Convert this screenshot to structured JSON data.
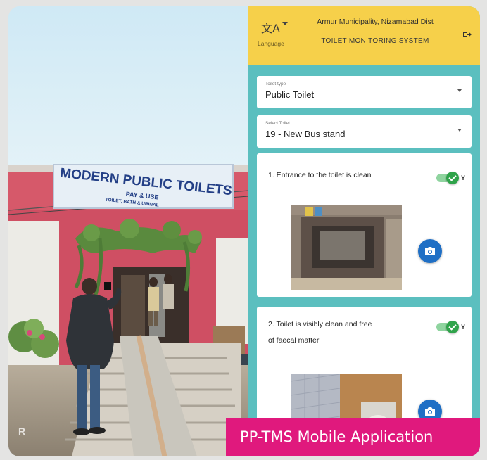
{
  "photo": {
    "sign_title": "MODERN PUBLIC TOILETS",
    "sign_line2": "PAY & USE",
    "sign_line3": "TOILET, BATH & URINAL",
    "watermark": "R"
  },
  "app": {
    "header": {
      "language_label": "Language",
      "language_icon": "translate-icon",
      "title": "Armur Municipality, Nizamabad Dist",
      "subtitle": "TOILET MONITORING SYSTEM",
      "logout_icon": "logout-icon",
      "background": "#f6d04a"
    },
    "toilet_type": {
      "caption": "Toilet type",
      "value": "Public Toilet"
    },
    "select_toilet": {
      "caption": "Select Toilet",
      "value": "19 - New Bus stand"
    },
    "questions": [
      {
        "text_line1": "1. Entrance to the toilet is clean",
        "text_line2": "",
        "answer": "Y",
        "toggle_on": true
      },
      {
        "text_line1": "2. Toilet is visibly clean and free",
        "text_line2": "of faecal matter",
        "answer": "Y",
        "toggle_on": true
      }
    ],
    "background": "#5bbfbf",
    "accent": "#1f6fc5",
    "toggle_color": "#2fa34a"
  },
  "banner": {
    "text": "PP-TMS Mobile Application",
    "color": "#e0197d"
  }
}
